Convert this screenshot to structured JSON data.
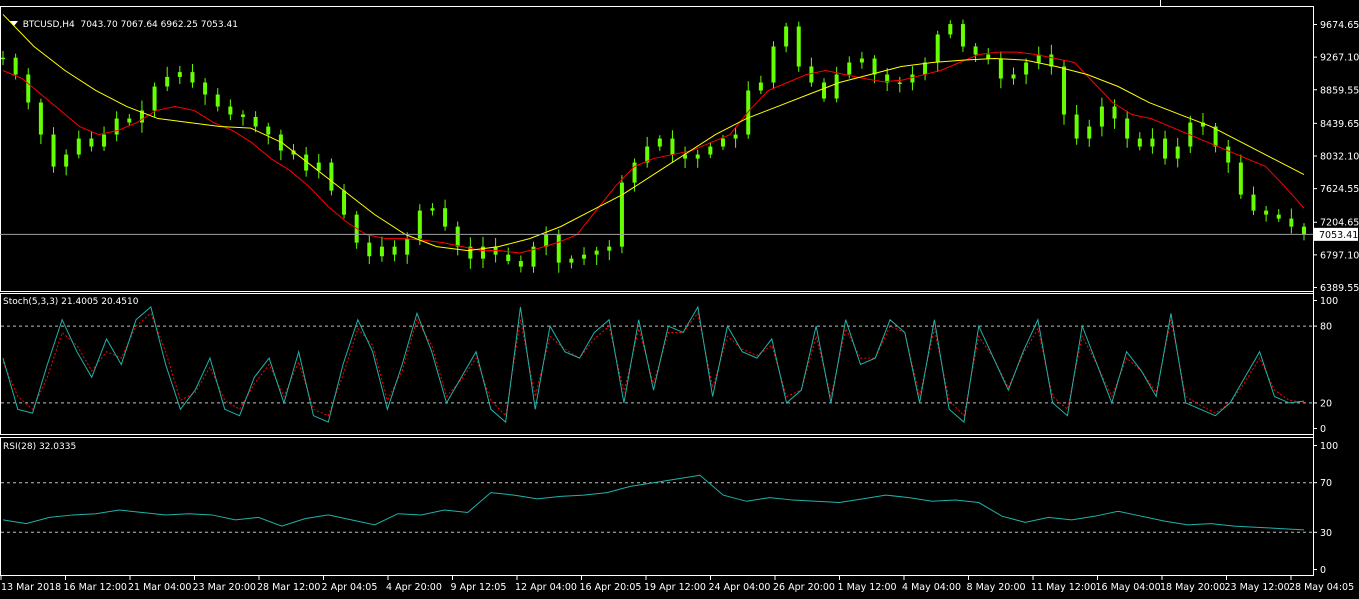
{
  "header": {
    "symbol": "BTCUSD,H4",
    "ohlc": "7043.70 7067.64 6962.25 7053.41"
  },
  "stoch": {
    "label": "Stoch(5,3,3) 21.4005 20.4510"
  },
  "rsi": {
    "label": "RSI(28) 32.0335"
  },
  "colors": {
    "background": "#000000",
    "frame": "#ffffff",
    "candle": "#66ff00",
    "ma_fast": "#ff0000",
    "ma_slow": "#ffff00",
    "stoch_main": "#20b2aa",
    "stoch_signal": "#ff0000",
    "rsi_line": "#20b2aa",
    "grid_dash": "#c0c0c0"
  },
  "chart_data": [
    {
      "type": "line",
      "title": "BTCUSD,H4",
      "subtitle": "7043.70 7067.64 6962.25 7053.41",
      "current_price": 7053.41,
      "current_price_label": "7053.41",
      "ylim": [
        6389.55,
        9674.65
      ],
      "y_ticks": [
        "9674.65",
        "9267.10",
        "8859.55",
        "8439.65",
        "8032.10",
        "7624.55",
        "7204.65",
        "6797.10",
        "6389.55"
      ],
      "y_tick_values": [
        9674.65,
        9267.1,
        8859.55,
        8439.65,
        8032.1,
        7624.55,
        7204.65,
        6797.1,
        6389.55
      ],
      "x_tick_labels": [
        "13 Mar 2018",
        "16 Mar 12:00",
        "21 Mar 04:00",
        "23 Mar 20:00",
        "28 Mar 12:00",
        "2 Apr 04:05",
        "4 Apr 20:00",
        "9 Apr 12:05",
        "12 Apr 04:00",
        "16 Apr 20:05",
        "19 Apr 12:00",
        "24 Apr 04:00",
        "26 Apr 20:00",
        "1 May 12:00",
        "4 May 04:00",
        "8 May 20:00",
        "11 May 12:00",
        "16 May 04:00",
        "18 May 20:00",
        "23 May 12:00",
        "28 May 04:05"
      ],
      "series": [
        {
          "kind": "close",
          "values": [
            9260,
            9050,
            8700,
            8300,
            7900,
            8050,
            8250,
            8150,
            8300,
            8500,
            8450,
            8600,
            8900,
            9020,
            9080,
            8950,
            8800,
            8650,
            8550,
            8520,
            8400,
            8300,
            8100,
            8050,
            7850,
            7950,
            7600,
            7300,
            6950,
            6780,
            6900,
            6800,
            7000,
            7350,
            7380,
            7150,
            6900,
            6750,
            6900,
            6800,
            6720,
            6650,
            6900,
            7050,
            6700,
            6750,
            6800,
            6850,
            6900,
            7700,
            7950,
            8150,
            8250,
            8050,
            8000,
            8050,
            8150,
            8250,
            8300,
            8850,
            8950,
            9400,
            9650,
            9150,
            8950,
            8750,
            9050,
            9200,
            9250,
            9050,
            8950,
            8950,
            9050,
            9200,
            9550,
            9680,
            9400,
            9300,
            9250,
            9000,
            9050,
            9200,
            9300,
            9150,
            8550,
            8250,
            8400,
            8650,
            8500,
            8250,
            8150,
            8250,
            8000,
            8150,
            8450,
            8400,
            8150,
            7950,
            7550,
            7350,
            7300,
            7250,
            7150,
            7053.41
          ]
        },
        {
          "kind": "moving_average_fast",
          "values": [
            9100,
            9000,
            8800,
            8600,
            8400,
            8300,
            8350,
            8450,
            8600,
            8650,
            8600,
            8450,
            8350,
            8200,
            8000,
            7850,
            7650,
            7400,
            7200,
            7050,
            7000,
            7000,
            6980,
            6950,
            6900,
            6850,
            6850,
            6820,
            6880,
            6950,
            7050,
            7350,
            7650,
            7900,
            8000,
            8050,
            8100,
            8200,
            8300,
            8600,
            8850,
            8950,
            9050,
            9100,
            9050,
            9000,
            8960,
            8980,
            9040,
            9100,
            9200,
            9300,
            9330,
            9330,
            9300,
            9250,
            9200,
            8950,
            8700,
            8550,
            8500,
            8400,
            8300,
            8200,
            8100,
            8000,
            7900,
            7650,
            7380
          ]
        },
        {
          "kind": "moving_average_slow",
          "values": [
            9800,
            9400,
            9100,
            8850,
            8650,
            8500,
            8450,
            8400,
            8380,
            8200,
            7900,
            7600,
            7300,
            7050,
            6900,
            6850,
            6900,
            7000,
            7150,
            7350,
            7550,
            7800,
            8050,
            8300,
            8500,
            8650,
            8800,
            8950,
            9050,
            9150,
            9200,
            9230,
            9250,
            9230,
            9150,
            9050,
            8900,
            8700,
            8550,
            8400,
            8200,
            8000,
            7800
          ]
        }
      ]
    },
    {
      "type": "line",
      "title": "Stoch(5,3,3)",
      "subtitle": "21.4005 20.4510",
      "ylim": [
        0,
        100
      ],
      "y_ticks": [
        "100",
        "80",
        "20",
        "0"
      ],
      "y_tick_values": [
        100,
        80,
        20,
        0
      ],
      "levels": [
        80,
        20
      ],
      "series": [
        {
          "kind": "main",
          "value": 21.4005,
          "values": [
            55,
            15,
            12,
            50,
            85,
            60,
            40,
            70,
            50,
            85,
            95,
            50,
            15,
            30,
            55,
            15,
            10,
            40,
            55,
            20,
            60,
            10,
            5,
            50,
            85,
            60,
            15,
            50,
            90,
            60,
            20,
            40,
            60,
            15,
            5,
            95,
            15,
            80,
            60,
            55,
            75,
            85,
            20,
            85,
            30,
            80,
            75,
            95,
            25,
            80,
            60,
            55,
            70,
            20,
            30,
            80,
            20,
            85,
            50,
            55,
            85,
            75,
            20,
            85,
            15,
            5,
            80,
            55,
            30,
            60,
            85,
            20,
            10,
            80,
            50,
            20,
            60,
            45,
            25,
            90,
            20,
            15,
            10,
            20,
            40,
            60,
            25,
            20,
            21.4
          ]
        },
        {
          "kind": "signal",
          "value": 20.451,
          "values": [
            52,
            25,
            15,
            40,
            75,
            65,
            45,
            60,
            55,
            80,
            90,
            60,
            22,
            28,
            48,
            22,
            15,
            35,
            50,
            25,
            52,
            15,
            10,
            42,
            78,
            65,
            22,
            45,
            85,
            65,
            25,
            38,
            55,
            22,
            10,
            85,
            25,
            72,
            62,
            55,
            70,
            80,
            28,
            78,
            35,
            75,
            75,
            90,
            32,
            72,
            62,
            57,
            65,
            25,
            30,
            72,
            25,
            78,
            55,
            55,
            80,
            75,
            25,
            78,
            22,
            10,
            72,
            55,
            32,
            58,
            78,
            25,
            15,
            72,
            50,
            25,
            55,
            45,
            28,
            85,
            25,
            18,
            12,
            20,
            36,
            55,
            30,
            22,
            20.45
          ]
        }
      ]
    },
    {
      "type": "line",
      "title": "RSI(28)",
      "subtitle": "32.0335",
      "ylim": [
        0,
        100
      ],
      "y_ticks": [
        "100",
        "70",
        "30",
        "0"
      ],
      "y_tick_values": [
        100,
        70,
        30,
        0
      ],
      "levels": [
        70,
        30
      ],
      "series": [
        {
          "kind": "rsi",
          "value": 32.0335,
          "values": [
            40,
            37,
            42,
            44,
            45,
            48,
            46,
            44,
            45,
            44,
            40,
            42,
            35,
            41,
            44,
            40,
            36,
            45,
            44,
            48,
            46,
            62,
            60,
            57,
            59,
            60,
            62,
            67,
            70,
            73,
            76,
            60,
            55,
            58,
            56,
            55,
            54,
            57,
            60,
            58,
            55,
            56,
            54,
            43,
            38,
            42,
            40,
            43,
            47,
            43,
            39,
            36,
            37,
            35,
            34,
            33,
            32
          ]
        }
      ]
    }
  ]
}
